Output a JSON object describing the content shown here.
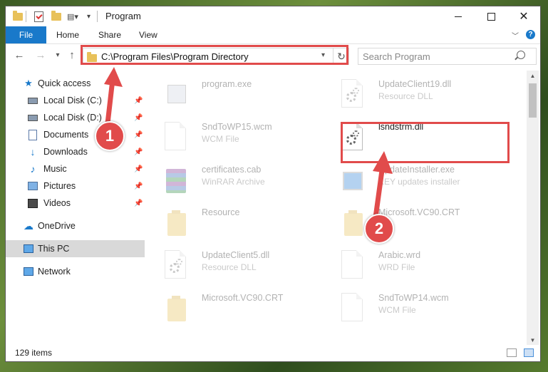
{
  "window": {
    "title": "Program"
  },
  "ribbon": {
    "tabs": [
      "File",
      "Home",
      "Share",
      "View"
    ],
    "help": "?"
  },
  "address": {
    "path": "C:\\Program Files\\Program Directory"
  },
  "search": {
    "placeholder": "Search Program"
  },
  "sidebar": {
    "items": [
      {
        "label": "Quick access",
        "icon": "star-icon"
      },
      {
        "label": "Local Disk (C:)",
        "icon": "drive-icon",
        "pinned": true
      },
      {
        "label": "Local Disk (D:)",
        "icon": "drive-icon",
        "pinned": true
      },
      {
        "label": "Documents",
        "icon": "documents-icon",
        "pinned": true
      },
      {
        "label": "Downloads",
        "icon": "download-icon",
        "pinned": true
      },
      {
        "label": "Music",
        "icon": "music-icon",
        "pinned": true
      },
      {
        "label": "Pictures",
        "icon": "pictures-icon",
        "pinned": true
      },
      {
        "label": "Videos",
        "icon": "videos-icon",
        "pinned": true
      },
      {
        "label": "OneDrive",
        "icon": "cloud-icon"
      },
      {
        "label": "This PC",
        "icon": "computer-icon",
        "selected": true
      },
      {
        "label": "Network",
        "icon": "network-icon"
      }
    ]
  },
  "files": [
    {
      "name": "program.exe",
      "type": "",
      "icon": "exe-icon"
    },
    {
      "name": "UpdateClient19.dll",
      "type": "Resource DLL",
      "icon": "dll-icon"
    },
    {
      "name": "SndToWP15.wcm",
      "type": "WCM File",
      "icon": "document-icon"
    },
    {
      "name": "lsndstrm.dll",
      "type": "",
      "icon": "dll-icon",
      "focused": true
    },
    {
      "name": "certificates.cab",
      "type": "WinRAR Archive",
      "icon": "archive-icon"
    },
    {
      "name": "UpdateInstaller.exe",
      "type": "KEY updates installer",
      "icon": "installer-icon"
    },
    {
      "name": "Resource",
      "type": "",
      "icon": "folder-icon"
    },
    {
      "name": "Microsoft.VC90.CRT",
      "type": "",
      "icon": "folder-icon"
    },
    {
      "name": "UpdateClient5.dll",
      "type": "Resource DLL",
      "icon": "dll-icon"
    },
    {
      "name": "Arabic.wrd",
      "type": "WRD File",
      "icon": "document-icon"
    },
    {
      "name": "Microsoft.VC90.CRT",
      "type": "",
      "icon": "folder-icon"
    },
    {
      "name": "SndToWP14.wcm",
      "type": "WCM File",
      "icon": "document-icon"
    }
  ],
  "status": {
    "count": "129 items"
  },
  "callouts": [
    "1",
    "2"
  ],
  "colors": {
    "accent": "#1979ca",
    "highlight": "#e14b4b",
    "selected": "#d9d9d9"
  }
}
